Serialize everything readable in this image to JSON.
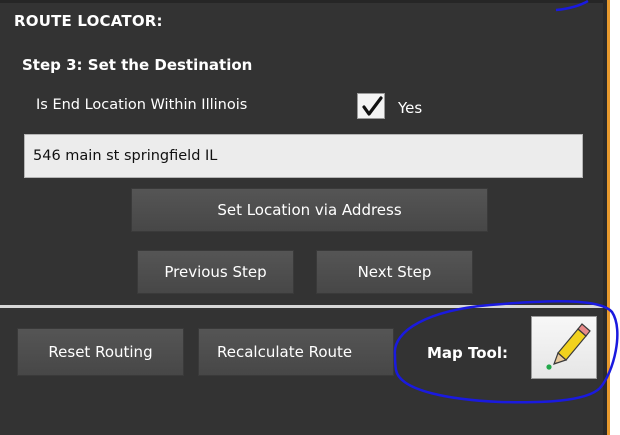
{
  "panel": {
    "header": "ROUTE LOCATOR:",
    "step_title": "Step 3:  Set the Destination",
    "question": "Is End Location Within Illinois",
    "checkbox_checked": true,
    "yes_label": "Yes",
    "address_value": "546 main st springfield IL",
    "set_location_label": "Set Location via Address",
    "previous_label": "Previous Step",
    "next_label": "Next Step"
  },
  "footer": {
    "reset_label": "Reset Routing",
    "recalc_label": "Recalculate Route",
    "map_tool_label": "Map Tool:",
    "map_tool_icon": "pencil-icon"
  },
  "colors": {
    "panel_bg": "#333333",
    "accent_orange": "#e89a2e",
    "annotation_blue": "#1a1adf"
  }
}
